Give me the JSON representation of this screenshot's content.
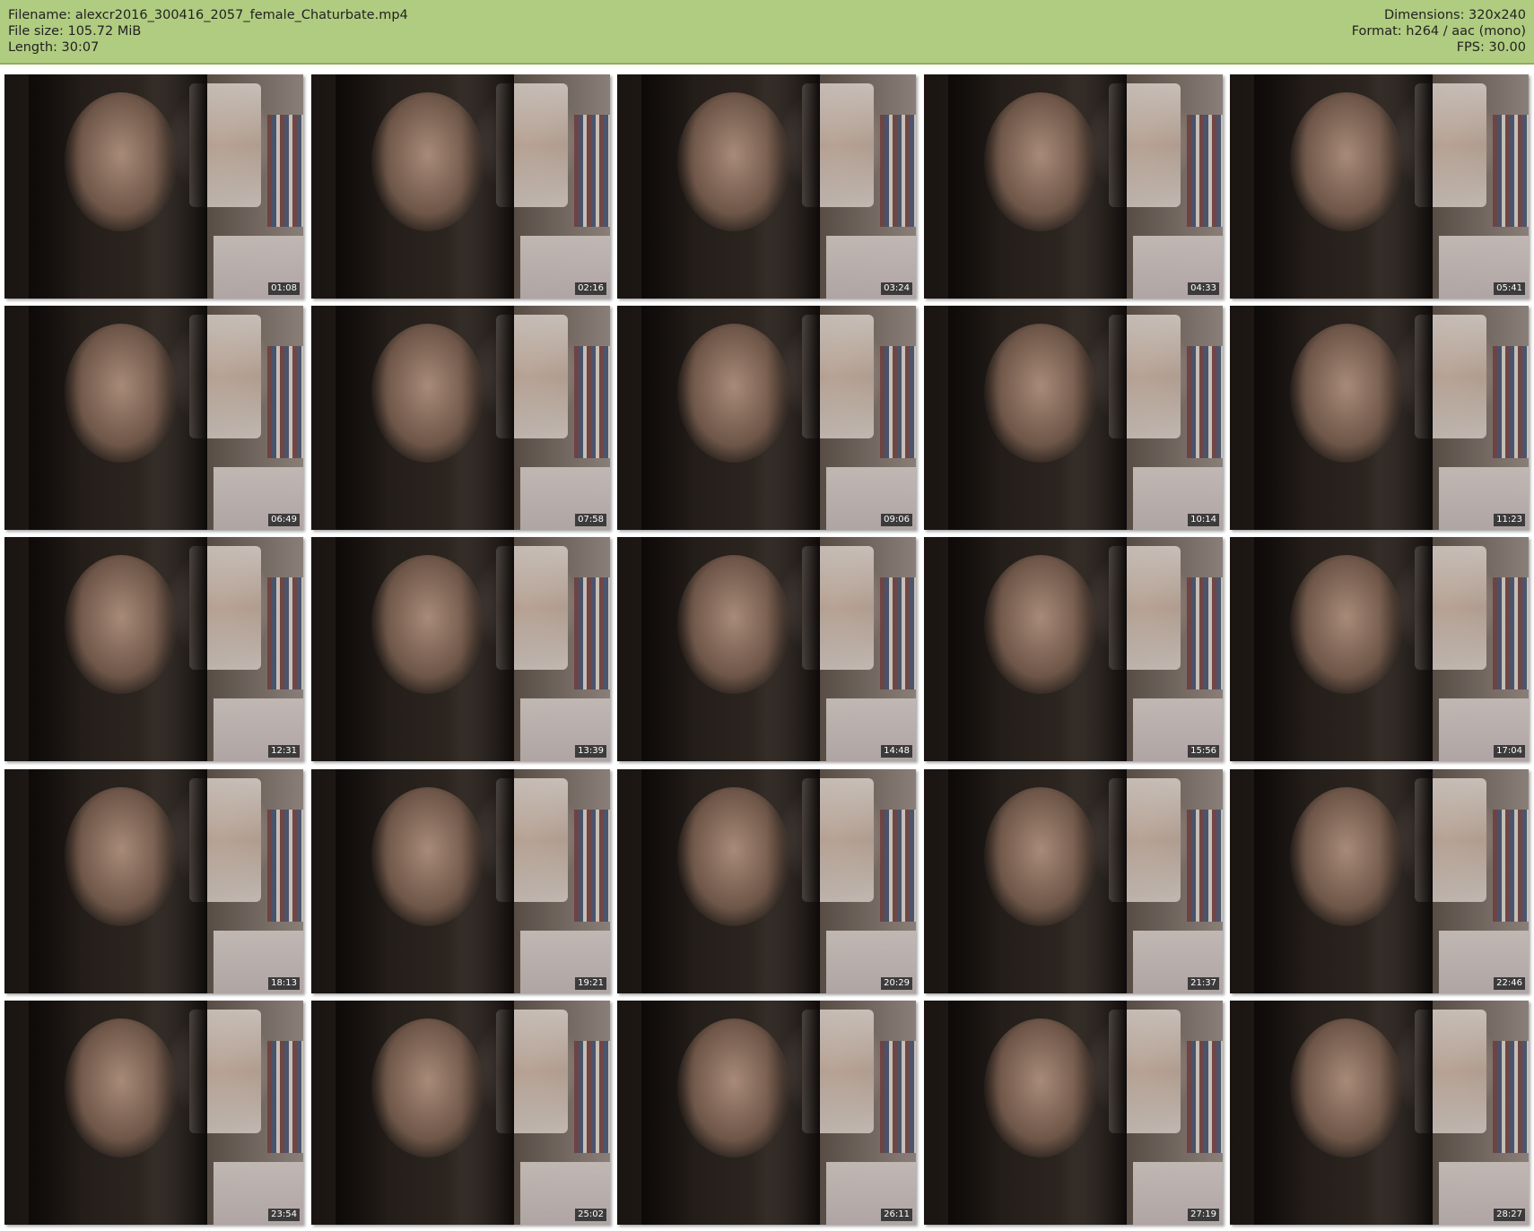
{
  "meta": {
    "filename": "Filename: alexcr2016_300416_2057_female_Chaturbate.mp4",
    "filesize": "File size: 105.72 MiB",
    "length": "Length: 30:07",
    "dimensions": "Dimensions: 320x240",
    "format": "Format: h264 / aac (mono)",
    "fps": "FPS: 30.00"
  },
  "colors": {
    "header_bg": "#b0cc80",
    "timestamp_bg": "#333333"
  },
  "thumbnails": [
    {
      "time": "01:08"
    },
    {
      "time": "02:16"
    },
    {
      "time": "03:24"
    },
    {
      "time": "04:33"
    },
    {
      "time": "05:41"
    },
    {
      "time": "06:49"
    },
    {
      "time": "07:58"
    },
    {
      "time": "09:06"
    },
    {
      "time": "10:14"
    },
    {
      "time": "11:23"
    },
    {
      "time": "12:31"
    },
    {
      "time": "13:39"
    },
    {
      "time": "14:48"
    },
    {
      "time": "15:56"
    },
    {
      "time": "17:04"
    },
    {
      "time": "18:13"
    },
    {
      "time": "19:21"
    },
    {
      "time": "20:29"
    },
    {
      "time": "21:37"
    },
    {
      "time": "22:46"
    },
    {
      "time": "23:54"
    },
    {
      "time": "25:02"
    },
    {
      "time": "26:11"
    },
    {
      "time": "27:19"
    },
    {
      "time": "28:27"
    }
  ]
}
